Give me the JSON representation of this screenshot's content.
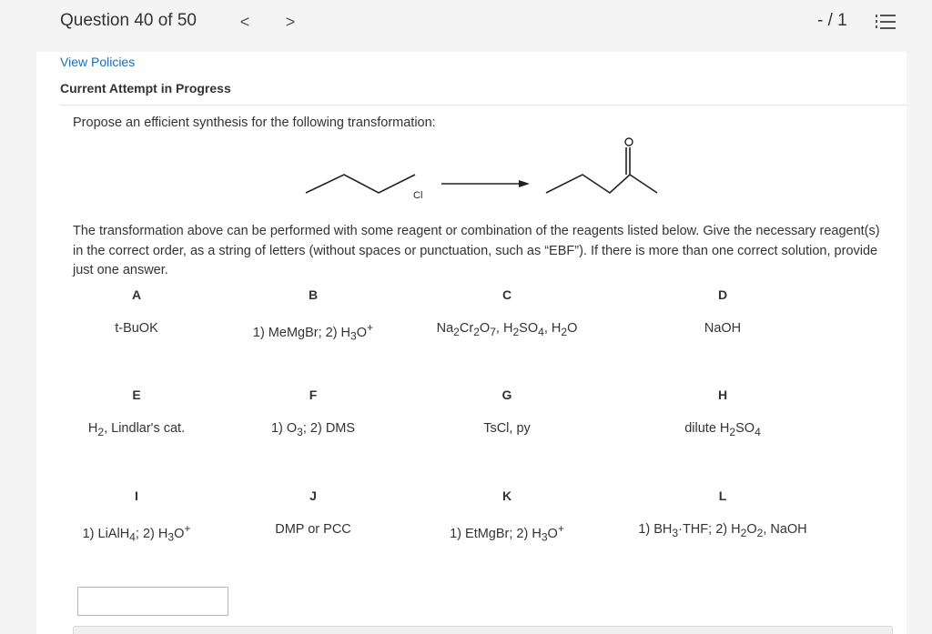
{
  "header": {
    "question_counter": "Question 40 of 50",
    "prev_label": "<",
    "next_label": ">",
    "score": "- / 1"
  },
  "links": {
    "view_policies": "View Policies"
  },
  "status": {
    "attempt": "Current Attempt in Progress"
  },
  "question": {
    "prompt": "Propose an efficient synthesis for the following transformation:",
    "scheme_label": "Cl",
    "instructions": "The transformation above can be performed with some reagent or combination of the reagents listed below. Give the necessary reagent(s) in the correct order, as a string of letters (without spaces or punctuation, such as “EBF”). If there is more than one correct solution, provide just one answer."
  },
  "reagents": [
    {
      "letter": "A",
      "html": "t-BuOK"
    },
    {
      "letter": "B",
      "html": "1) MeMgBr; 2) H<sub>3</sub>O<sup>+</sup>"
    },
    {
      "letter": "C",
      "html": "Na<sub>2</sub>Cr<sub>2</sub>O<sub>7</sub>, H<sub>2</sub>SO<sub>4</sub>, H<sub>2</sub>O"
    },
    {
      "letter": "D",
      "html": "NaOH"
    },
    {
      "letter": "E",
      "html": "H<sub>2</sub>, Lindlar's cat."
    },
    {
      "letter": "F",
      "html": "1) O<sub>3</sub>; 2) DMS"
    },
    {
      "letter": "G",
      "html": "TsCl, py"
    },
    {
      "letter": "H",
      "html": "dilute H<sub>2</sub>SO<sub>4</sub>"
    },
    {
      "letter": "I",
      "html": "1) LiAlH<sub>4</sub>; 2) H<sub>3</sub>O<sup>+</sup>"
    },
    {
      "letter": "J",
      "html": "DMP or PCC"
    },
    {
      "letter": "K",
      "html": "1) EtMgBr; 2) H<sub>3</sub>O<sup>+</sup>"
    },
    {
      "letter": "L",
      "html": "1) BH<sub>3</sub>·THF; 2) H<sub>2</sub>O<sub>2</sub>, NaOH"
    }
  ],
  "answer": {
    "value": "",
    "placeholder": ""
  },
  "icons": {
    "prev": "chevron-left-icon",
    "next": "chevron-right-icon",
    "list": "list-icon"
  }
}
